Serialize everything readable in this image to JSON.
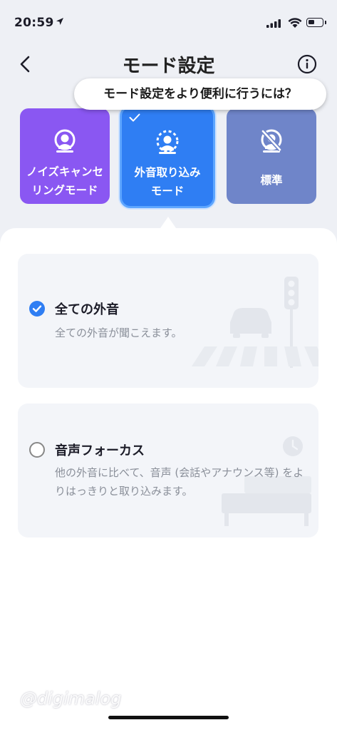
{
  "status_bar": {
    "time": "20:59"
  },
  "header": {
    "title": "モード設定"
  },
  "tooltip": {
    "text": "モード設定をより便利に行うには？"
  },
  "modes": [
    {
      "label": "ノイズキャンセリングモード",
      "line1": "ノイズキャンセ",
      "line2": "リングモード",
      "icon": "noise-cancel-icon",
      "color": "#8a57f2"
    },
    {
      "label": "外音取り込みモード",
      "line1": "外音取り込み",
      "line2": "モード",
      "icon": "ambient-sound-icon",
      "color": "#2f7ef3",
      "selected": true
    },
    {
      "label": "標準",
      "line1": "標準",
      "line2": "",
      "icon": "standard-mode-icon",
      "color": "#6f85c9"
    }
  ],
  "options": [
    {
      "title": "全ての外音",
      "description": "全ての外音が聞こえます。",
      "selected": true
    },
    {
      "title": "音声フォーカス",
      "description": "他の外音に比べて、音声 (会話やアナウンス等) をよりはっきりと取り込みます。",
      "selected": false
    }
  ],
  "watermark": "@digimalog",
  "colors": {
    "accent": "#2f7ef3",
    "background": "#eef0f5"
  }
}
